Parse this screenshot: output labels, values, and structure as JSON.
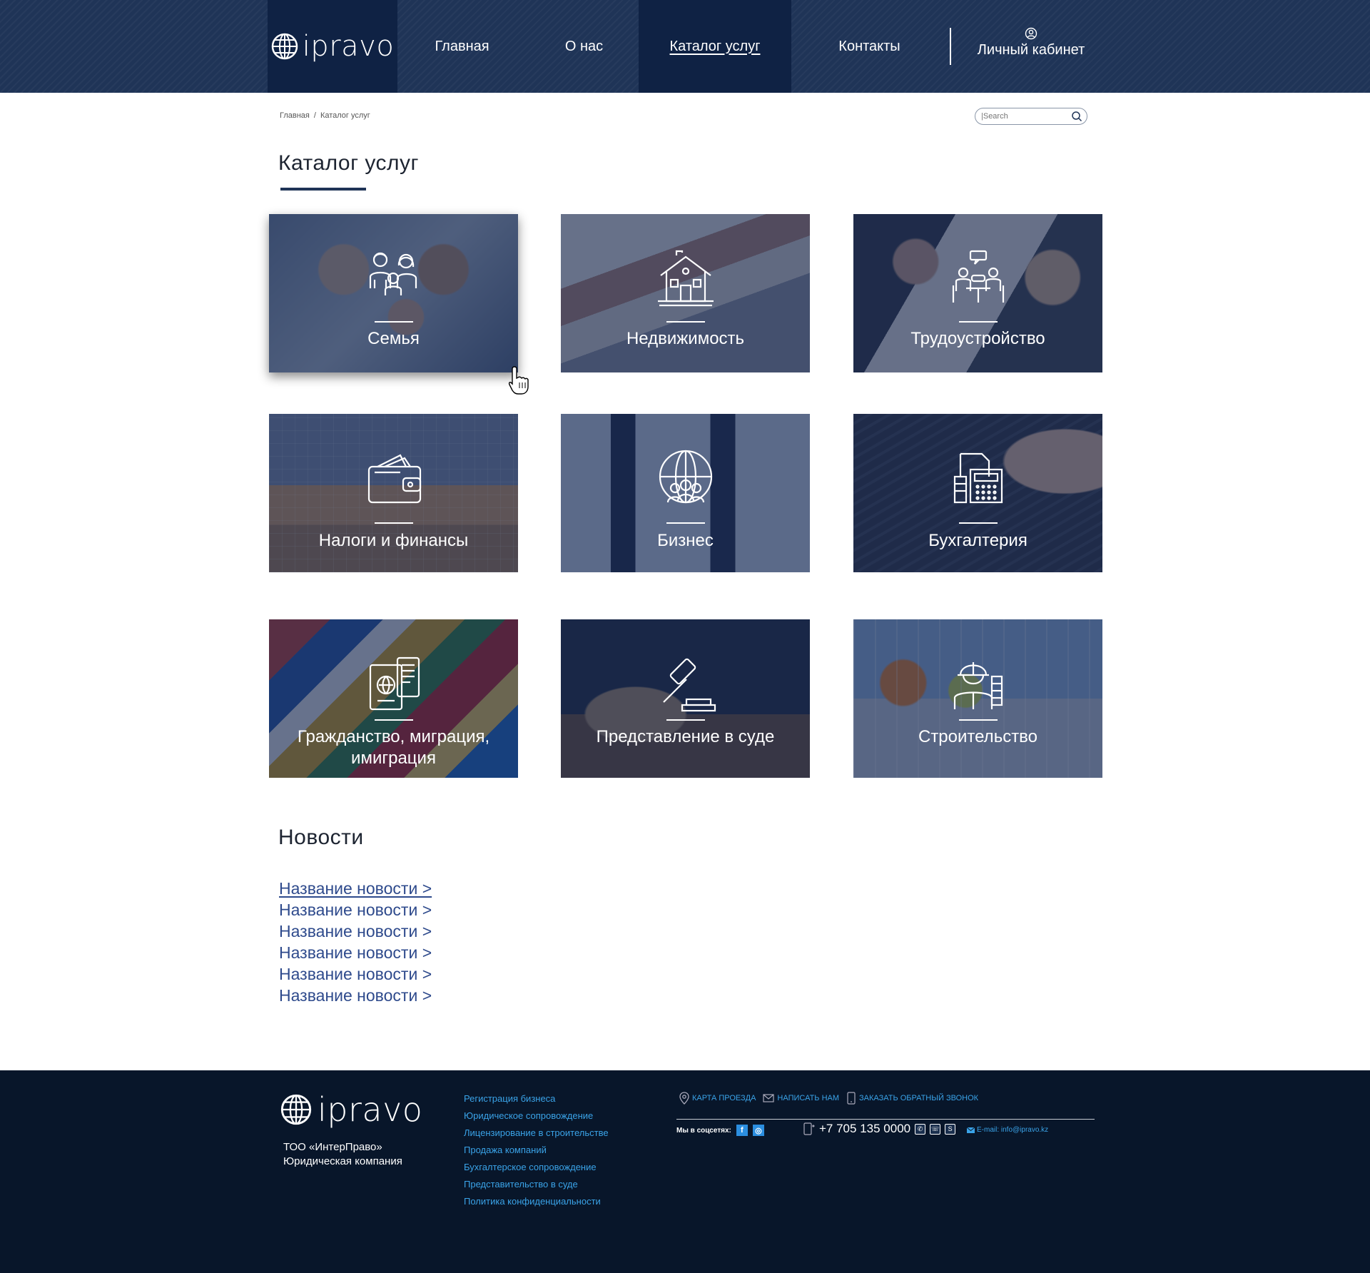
{
  "header": {
    "logo": "ipravo",
    "nav": [
      {
        "label": "Главная"
      },
      {
        "label": "О нас"
      },
      {
        "label": "Каталог услуг"
      },
      {
        "label": "Контакты"
      }
    ],
    "cabinet_label": "Личный кабинет"
  },
  "breadcrumb": {
    "home": "Главная",
    "separator": "/",
    "current": "Каталог услуг"
  },
  "search": {
    "placeholder": "|Search"
  },
  "page_title": "Каталог услуг",
  "cards": [
    {
      "label": "Семья",
      "icon": "family-icon"
    },
    {
      "label": "Недвижимость",
      "icon": "house-icon"
    },
    {
      "label": "Трудоустройство",
      "icon": "meeting-icon"
    },
    {
      "label": "Налоги и финансы",
      "icon": "wallet-icon"
    },
    {
      "label": "Бизнес",
      "icon": "globe-people-icon"
    },
    {
      "label": "Бухгалтерия",
      "icon": "calculator-icon"
    },
    {
      "label": "Гражданство, миграция, имиграция",
      "icon": "passport-icon"
    },
    {
      "label": "Представление в суде",
      "icon": "gavel-icon"
    },
    {
      "label": "Строительство",
      "icon": "builder-icon"
    }
  ],
  "news": {
    "title": "Новости",
    "items": [
      "Название новости >",
      "Название новости >",
      "Название новости >",
      "Название новости >",
      "Название новости >",
      "Название новости >"
    ]
  },
  "footer": {
    "logo": "ipravo",
    "company_line1": "ТОО «ИнтерПраво»",
    "company_line2": "Юридическая компания",
    "links": [
      "Регистрация бизнеса",
      "Юридическое сопровождение",
      "Лицензирование в строительстве",
      "Продажа компаний",
      "Бухгалтерское сопровождение",
      "Представительство в суде",
      "Политика конфиденциальности"
    ],
    "map_label": "КАРТА ПРОЕЗДА",
    "write_label": "НАПИСАТЬ НАМ",
    "callback_label": "ЗАКАЗАТЬ ОБРАТНЫЙ ЗВОНОК",
    "social_label": "Мы в соцсетях:",
    "phone": "+7 705 135 0000",
    "email": "E-mail: info@ipravo.kz"
  },
  "colors": {
    "header_bg": "#1f3457",
    "header_active": "#0f2244",
    "card_overlay": "#182a54",
    "link": "#2e4a8c",
    "footer_bg": "#08162a",
    "footer_link": "#3aa3e8"
  }
}
